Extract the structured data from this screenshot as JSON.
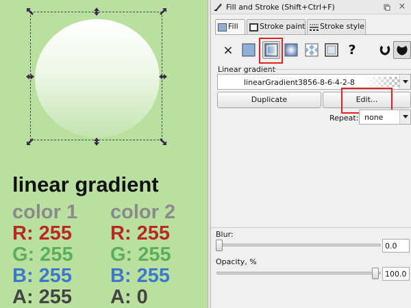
{
  "canvas": {
    "heading": "linear gradient",
    "color1": {
      "title": "color 1",
      "r": "R: 255",
      "g": "G: 255",
      "b": "B: 255",
      "a": "A: 255"
    },
    "color2": {
      "title": "color 2",
      "r": "R: 255",
      "g": "G: 255",
      "b": "B: 255",
      "a": "A: 0"
    }
  },
  "panel": {
    "title": "Fill and Stroke (Shift+Ctrl+F)",
    "tabs": [
      {
        "label": "Fill"
      },
      {
        "label": "Stroke paint"
      },
      {
        "label": "Stroke style"
      }
    ],
    "paint_types": [
      "no-paint",
      "flat-color",
      "linear-gradient",
      "radial-gradient",
      "pattern",
      "swatch",
      "unset"
    ],
    "unset_glyph": "?",
    "no_paint_glyph": "×",
    "gradient_section_label": "Linear gradient",
    "gradient_name": "linearGradient3856-8-6-4-2-8",
    "duplicate_label": "Duplicate",
    "edit_label": "Edit...",
    "repeat_label": "Repeat:",
    "repeat_value": "none",
    "blur_label": "Blur:",
    "blur_value": "0.0",
    "opacity_label": "Opacity, %",
    "opacity_value": "100.0",
    "close_glyph": "×"
  },
  "colors": {
    "canvas_bg": "#b9e09f",
    "highlight": "#e02020"
  }
}
